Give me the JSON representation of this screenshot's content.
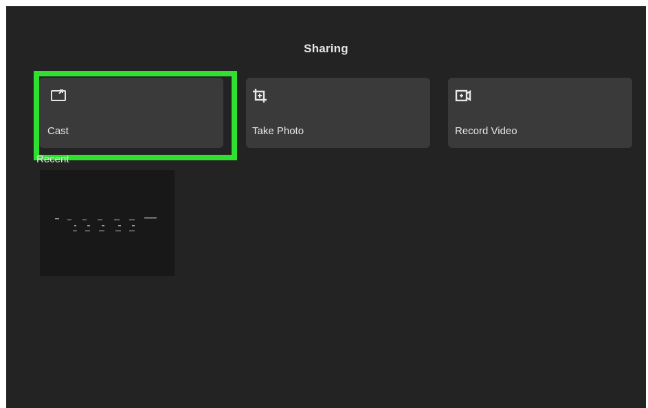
{
  "header": {
    "title": "Sharing"
  },
  "actions": [
    {
      "label": "Cast",
      "icon": "cast-icon",
      "selected": true
    },
    {
      "label": "Take Photo",
      "icon": "crop-photo-icon",
      "selected": false
    },
    {
      "label": "Record Video",
      "icon": "video-camera-icon",
      "selected": false
    }
  ],
  "recent": {
    "label": "Recent",
    "items": [
      {
        "icon": "screenshot-thumbnail"
      }
    ]
  },
  "colors": {
    "background": "#232323",
    "tile": "#3a3a3a",
    "focus": "#2fe02f",
    "text": "#e8e8e8"
  }
}
